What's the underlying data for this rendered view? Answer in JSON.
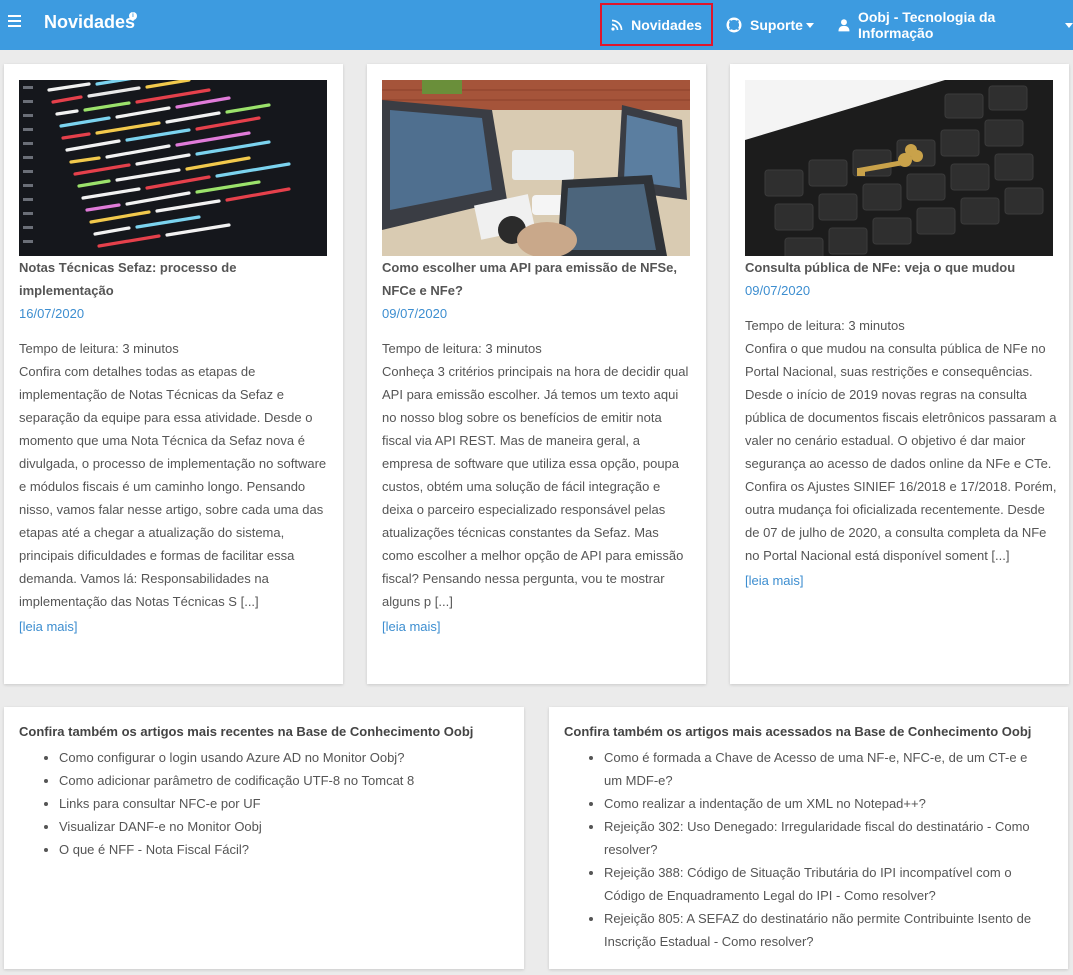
{
  "header": {
    "brand": "Novidades",
    "brand_badge": "i",
    "nav": {
      "novidades": "Novidades",
      "suporte": "Suporte",
      "user": "Oobj - Tecnologia da Informação"
    }
  },
  "articles": [
    {
      "title": "Notas Técnicas Sefaz: processo de implementação",
      "date": "16/07/2020",
      "read_time": "Tempo de leitura: 3 minutos",
      "excerpt": "Confira com detalhes todas as etapas de implementação de Notas Técnicas da Sefaz e separação da equipe para essa atividade. Desde o momento que uma Nota Técnica da Sefaz nova é divulgada, o processo de implementação no software e módulos fiscais é um caminho longo. Pensando nisso, vamos falar nesse artigo, sobre cada uma das etapas até a chegar a atualização do sistema, principais dificuldades e formas de facilitar essa demanda.  Vamos lá: Responsabilidades na implementação das Notas Técnicas S [...]",
      "more": "[leia mais]"
    },
    {
      "title": "Como escolher uma API para emissão de NFSe, NFCe e NFe?",
      "date": "09/07/2020",
      "read_time": "Tempo de leitura: 3 minutos",
      "excerpt": "Conheça 3 critérios principais na hora de decidir qual API para emissão escolher. Já temos um texto aqui no nosso blog sobre os benefícios de emitir nota fiscal via API REST. Mas de maneira geral, a empresa de software que utiliza essa opção, poupa custos, obtém uma solução de fácil integração e deixa o parceiro especializado responsável pelas atualizações técnicas constantes da Sefaz. Mas como escolher a melhor opção de API para emissão fiscal?  Pensando nessa pergunta, vou te mostrar alguns p [...]",
      "more": "[leia mais]"
    },
    {
      "title": "Consulta pública de NFe: veja o que mudou",
      "date": "09/07/2020",
      "read_time": "Tempo de leitura: 3 minutos",
      "excerpt": "Confira o que mudou na consulta pública de NFe no Portal Nacional, suas restrições e consequências. Desde o início de 2019 novas regras na consulta pública de documentos fiscais eletrônicos passaram a valer no cenário estadual. O objetivo é dar maior segurança ao acesso de dados online da NFe e CTe. Confira os Ajustes SINIEF 16/2018 e 17/2018. Porém, outra mudança foi oficializada recentemente. Desde de 07 de julho de 2020, a consulta completa da NFe no Portal Nacional está disponível soment [...]",
      "more": "[leia mais]"
    }
  ],
  "recent": {
    "title": "Confira também os artigos mais recentes na Base de Conhecimento Oobj",
    "items": [
      "Como configurar o login usando Azure AD no Monitor Oobj?",
      "Como adicionar parâmetro de codificação UTF-8 no Tomcat 8",
      "Links para consultar NFC-e por UF",
      "Visualizar DANF-e no Monitor Oobj",
      "O que é NFF - Nota Fiscal Fácil?"
    ]
  },
  "popular": {
    "title": "Confira também os artigos mais acessados na Base de Conhecimento Oobj",
    "items": [
      "Como é formada a Chave de Acesso de uma NF-e, NFC-e, de um CT-e e um MDF-e?",
      "Como realizar a indentação de um XML no Notepad++?",
      "Rejeição 302: Uso Denegado: Irregularidade fiscal do destinatário - Como resolver?",
      "Rejeição 388: Código de Situação Tributária do IPI incompatível com o Código de Enquadramento Legal do IPI - Como resolver?",
      "Rejeição 805: A SEFAZ do destinatário não permite Contribuinte Isento de Inscrição Estadual - Como resolver?"
    ]
  }
}
